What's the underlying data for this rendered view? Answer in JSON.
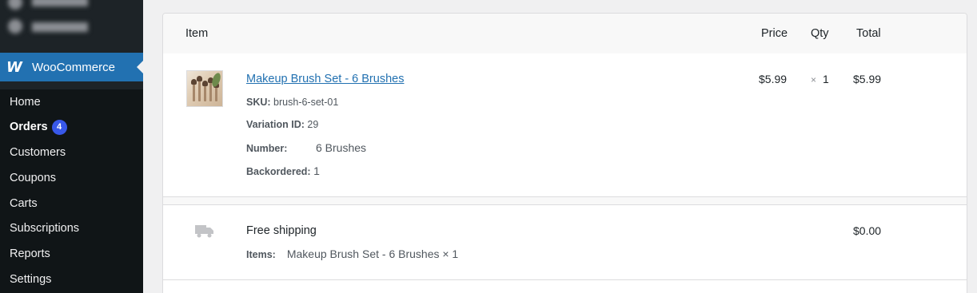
{
  "sidebar": {
    "plugin_label": "WooCommerce",
    "plugin_logo": "W",
    "items": [
      {
        "label": "Home"
      },
      {
        "label": "Orders",
        "badge": "4"
      },
      {
        "label": "Customers"
      },
      {
        "label": "Coupons"
      },
      {
        "label": "Carts"
      },
      {
        "label": "Subscriptions"
      },
      {
        "label": "Reports"
      },
      {
        "label": "Settings"
      }
    ]
  },
  "table": {
    "headers": {
      "item": "Item",
      "price": "Price",
      "qty": "Qty",
      "total": "Total"
    },
    "line_item": {
      "name": "Makeup Brush Set - 6 Brushes",
      "sku_label": "SKU:",
      "sku": "brush-6-set-01",
      "variation_label": "Variation ID:",
      "variation_id": "29",
      "number_label": "Number:",
      "number": "6 Brushes",
      "backordered_label": "Backordered:",
      "backordered": "1",
      "price": "$5.99",
      "qty_symbol": "×",
      "qty": "1",
      "total": "$5.99"
    },
    "shipping": {
      "method": "Free shipping",
      "items_label": "Items:",
      "items": "Makeup Brush Set - 6 Brushes × 1",
      "total": "$0.00"
    }
  },
  "colors": {
    "accent": "#2271b1",
    "badge": "#3858e9",
    "sidebar": "#1d2327"
  }
}
